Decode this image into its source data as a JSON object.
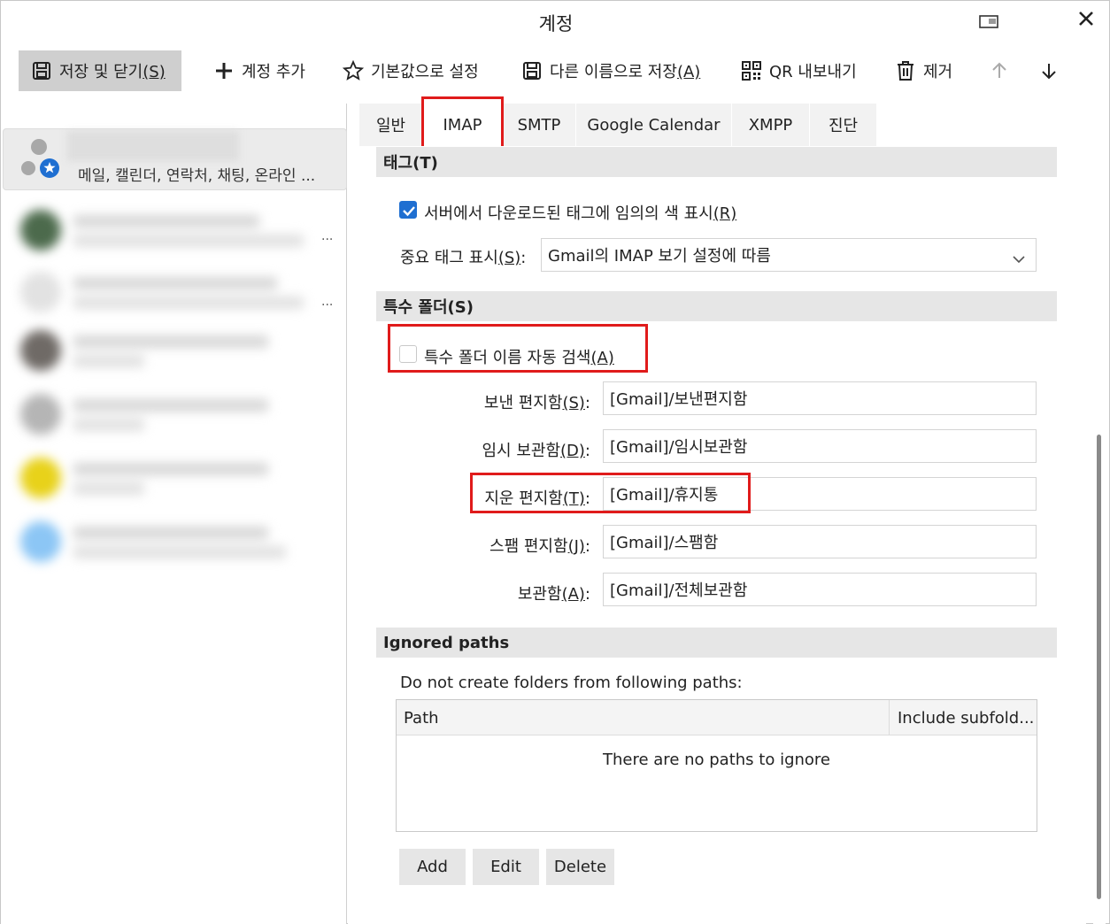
{
  "window": {
    "title": "계정"
  },
  "toolbar": {
    "save_close": {
      "label": "저장 및 닫기",
      "accel": "(S)"
    },
    "add_account": {
      "label": "계정 추가"
    },
    "set_default": {
      "label": "기본값으로 설정"
    },
    "save_as": {
      "label": "다른 이름으로 저장",
      "accel": "(A)"
    },
    "qr_export": {
      "label": "QR 내보내기"
    },
    "remove": {
      "label": "제거"
    }
  },
  "accounts": {
    "selected": {
      "subtitle": "메일, 캘린더, 연락처, 채팅, 온라인 ..."
    },
    "ellipsis": "..."
  },
  "tabs": [
    "일반",
    "IMAP",
    "SMTP",
    "Google Calendar",
    "XMPP",
    "진단"
  ],
  "active_tab": "IMAP",
  "tags_section": {
    "title": "태그(T)",
    "show_random_colors": {
      "label": "서버에서 다운로드된 태그에 임의의 색 표시",
      "accel": "(R)",
      "checked": true
    },
    "important_tag_label": {
      "label": "중요 태그 표시",
      "accel": "(S)",
      "colon": ":"
    },
    "important_tag_value": "Gmail의 IMAP 보기 설정에 따름"
  },
  "special_folders": {
    "title": "특수 폴더(S)",
    "auto_detect": {
      "label": "특수 폴더 이름 자동 검색",
      "accel": "(A)",
      "checked": false
    },
    "sent": {
      "label": "보낸 편지함",
      "accel": "(S)",
      "colon": ":",
      "value": "[Gmail]/보낸편지함"
    },
    "drafts": {
      "label": "임시 보관함",
      "accel": "(D)",
      "colon": ":",
      "value": "[Gmail]/임시보관함"
    },
    "trash": {
      "label": "지운 편지함",
      "accel": "(T)",
      "colon": ":",
      "value": "[Gmail]/휴지통"
    },
    "spam": {
      "label": "스팸 편지함",
      "accel": "(J)",
      "colon": ":",
      "value": "[Gmail]/스팸함"
    },
    "archive": {
      "label": "보관함",
      "accel": "(A)",
      "colon": ":",
      "value": "[Gmail]/전체보관함"
    }
  },
  "ignored_paths": {
    "title": "Ignored paths",
    "description": "Do not create folders from following paths:",
    "columns": [
      "Path",
      "Include subfold..."
    ],
    "empty_message": "There are no paths to ignore",
    "buttons": {
      "add": "Add",
      "edit": "Edit",
      "delete": "Delete"
    }
  },
  "colors": {
    "highlight": "#e01b1b",
    "checkbox": "#1f6fd1",
    "section_bg": "#e6e6e6"
  }
}
